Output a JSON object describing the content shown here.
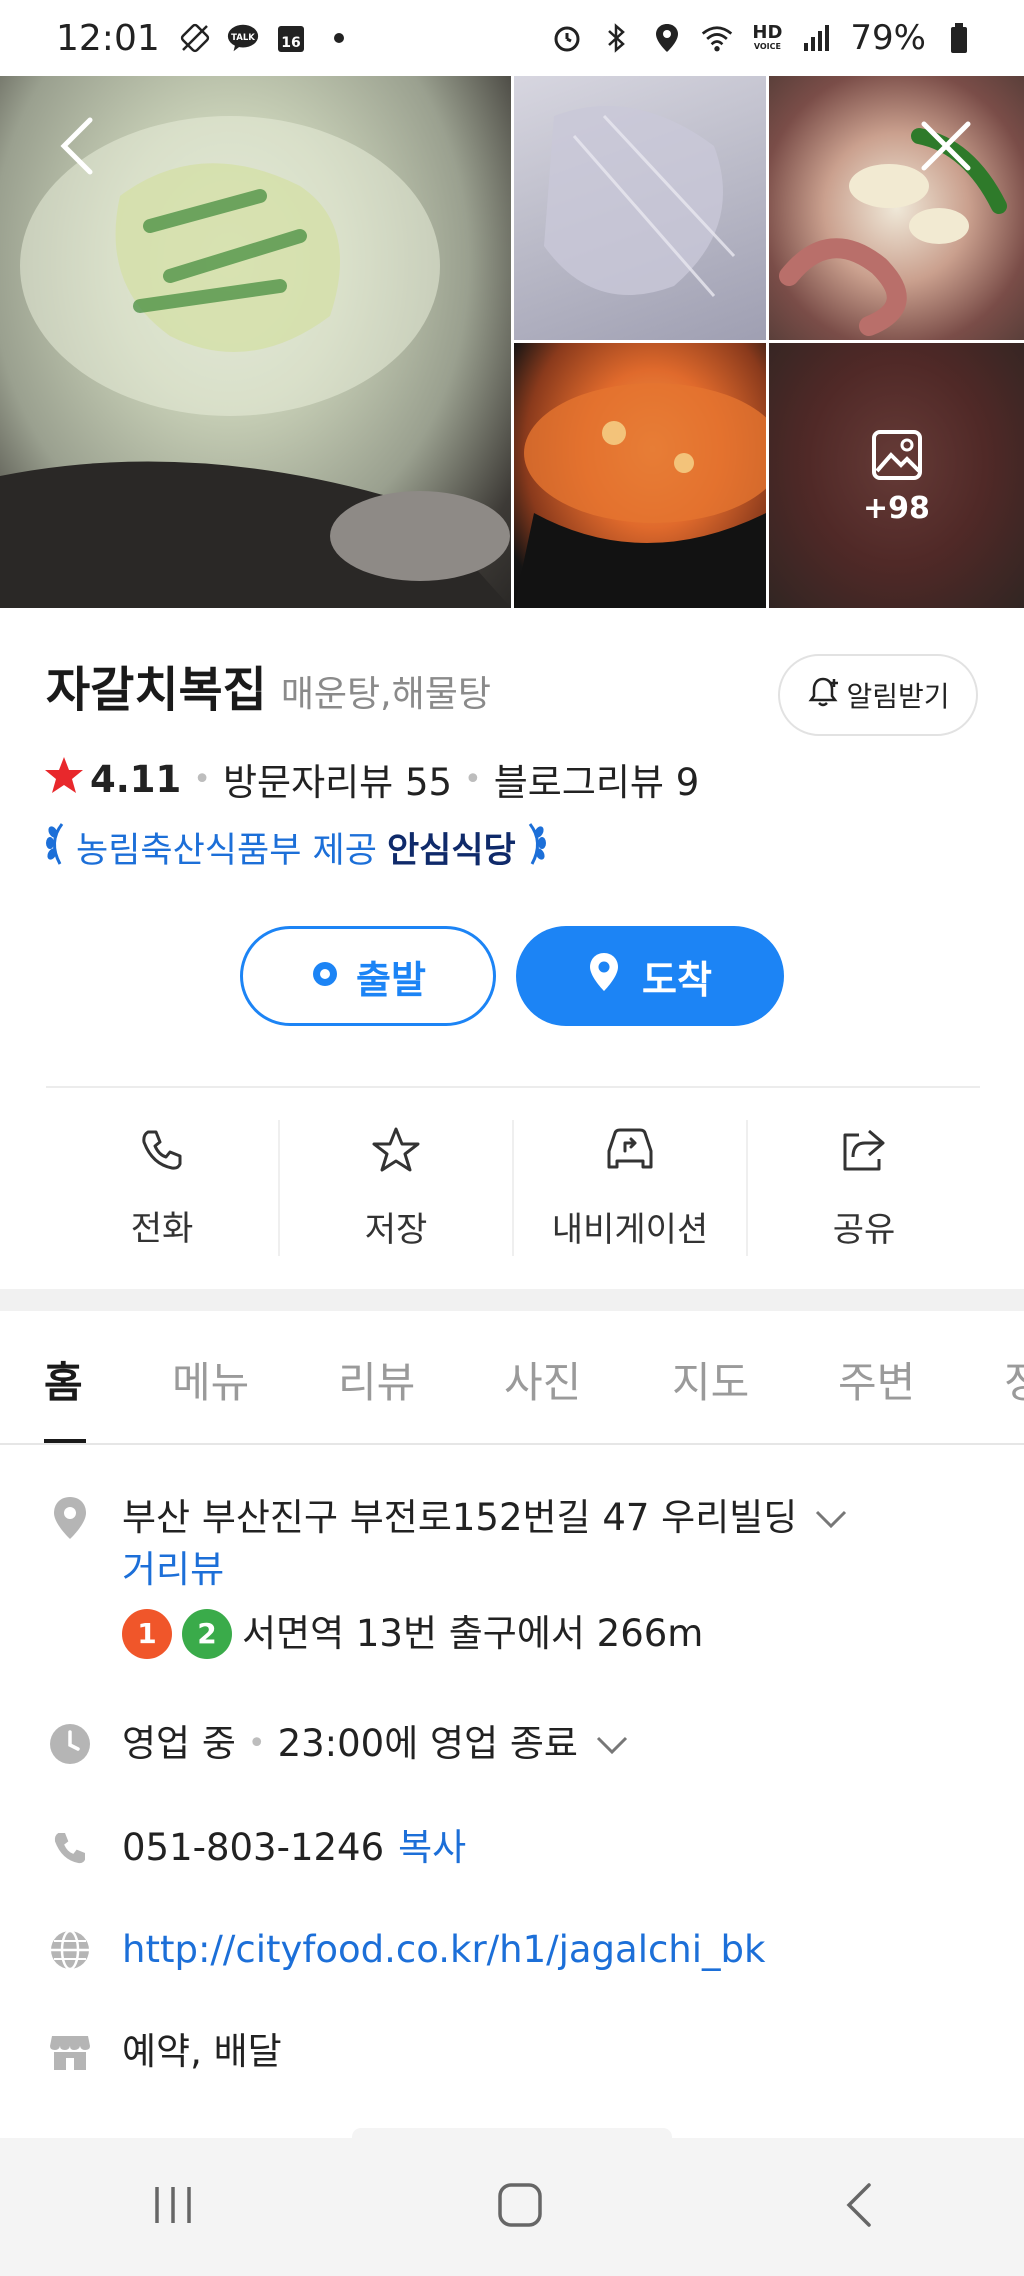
{
  "status_bar": {
    "time": "12:01",
    "battery": "79%",
    "calendar_day": "16",
    "talk_label": "TALK",
    "hd_label": "HD",
    "voice_label": "VOICE"
  },
  "gallery": {
    "more_count": "+98"
  },
  "place": {
    "name": "자갈치복집",
    "category": "매운탕,해물탕",
    "alert_button": "알림받기",
    "rating": "4.11",
    "visitor_reviews": "방문자리뷰 55",
    "blog_reviews": "블로그리뷰 9",
    "cert_provider": "농림축산식품부 제공",
    "cert_name": "안심식당"
  },
  "route": {
    "start_label": "출발",
    "destination_label": "도착"
  },
  "actions": [
    {
      "label": "전화",
      "icon": "phone-icon"
    },
    {
      "label": "저장",
      "icon": "star-icon"
    },
    {
      "label": "내비게이션",
      "icon": "car-navigation-icon"
    },
    {
      "label": "공유",
      "icon": "share-icon"
    }
  ],
  "tabs": [
    "홈",
    "메뉴",
    "리뷰",
    "사진",
    "지도",
    "주변",
    "정"
  ],
  "active_tab": "홈",
  "info": {
    "address": "부산 부산진구 부전로152번길 47 우리빌딩",
    "street_view": "거리뷰",
    "subway_line_1": "1",
    "subway_line_2": "2",
    "subway_text": "서면역 13번 출구에서 266m",
    "hours_status": "영업 중",
    "hours_text": "23:00에 영업 종료",
    "phone": "051-803-1246",
    "copy_label": "복사",
    "website": "http://cityfood.co.kr/h1/jagalchi_bk",
    "services": "예약, 배달"
  },
  "colors": {
    "accent_blue": "#1c84f5",
    "link_blue": "#1c6fd8",
    "star_red": "#e8282c",
    "line1_orange": "#f0562a",
    "line2_green": "#3aab4a"
  }
}
